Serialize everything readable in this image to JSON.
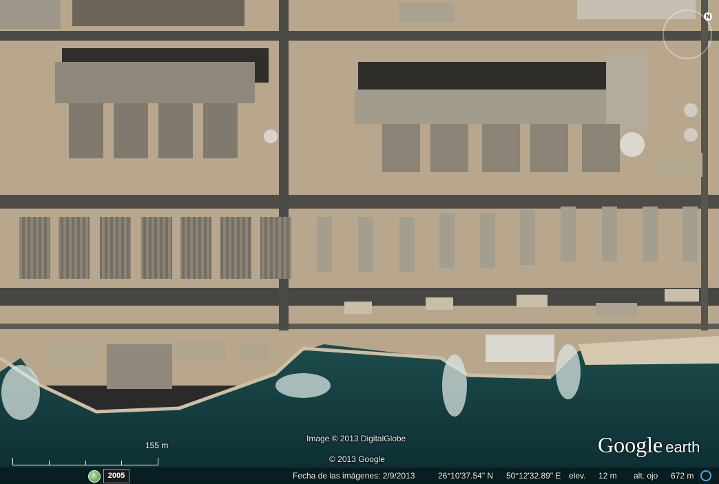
{
  "imagery": {
    "credit_image": "Image © 2013 DigitalGlobe",
    "credit_data": "© 2013 Google"
  },
  "logo": {
    "brand": "Google",
    "product": "earth"
  },
  "scale": {
    "label": "155 m"
  },
  "status": {
    "historical_year": "2005",
    "imagery_date": "Fecha de las imágenes: 2/9/2013",
    "latitude": "26°10'37.54\" N",
    "longitude": "50°12'32.89\" E",
    "elevation_label": "elev.",
    "elevation_value": "12 m",
    "eye_alt_label": "alt. ojo",
    "eye_alt_value": "672 m"
  },
  "navigation": {
    "north_label": "N"
  },
  "colors": {
    "sea": "#123a3c",
    "sand": "#b9a88e",
    "road": "#4b4b48",
    "building": "#8d8675"
  },
  "icons": [
    "clock-icon",
    "streaming-icon",
    "compass-ring-icon"
  ]
}
